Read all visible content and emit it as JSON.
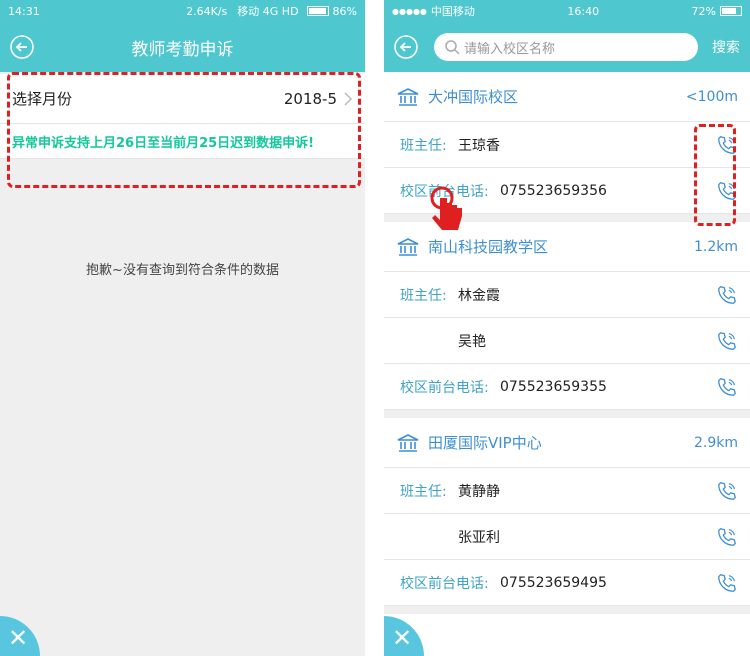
{
  "left": {
    "status": {
      "time": "14:31",
      "net": "2.64K/s",
      "carrier": "移动 4G HD",
      "battery": "86%"
    },
    "title": "教师考勤申诉",
    "month_label": "选择月份",
    "month_value": "2018-5",
    "notice": "异常申诉支持上月26日至当前月25日迟到数据申诉!",
    "empty_message": "抱歉~没有查询到符合条件的数据"
  },
  "right": {
    "status": {
      "carrier": "中国移动",
      "time": "16:40",
      "battery": "72%"
    },
    "search_placeholder": "请输入校区名称",
    "search_button": "搜索",
    "labels": {
      "head_teacher": "班主任:",
      "front_desk": "校区前台电话:"
    },
    "campuses": [
      {
        "name": "大冲国际校区",
        "distance": "<100m",
        "teachers": [
          "王琼香"
        ],
        "phone": "075523659356"
      },
      {
        "name": "南山科技园教学区",
        "distance": "1.2km",
        "teachers": [
          "林金霞",
          "吴艳"
        ],
        "phone": "075523659355"
      },
      {
        "name": "田厦国际VIP中心",
        "distance": "2.9km",
        "teachers": [
          "黄静静",
          "张亚利"
        ],
        "phone": "075523659495"
      }
    ]
  },
  "colors": {
    "primary": "#4ec7cf",
    "accent_text": "#3e8fd2",
    "notice": "#14c79c",
    "highlight": "#e02020"
  }
}
